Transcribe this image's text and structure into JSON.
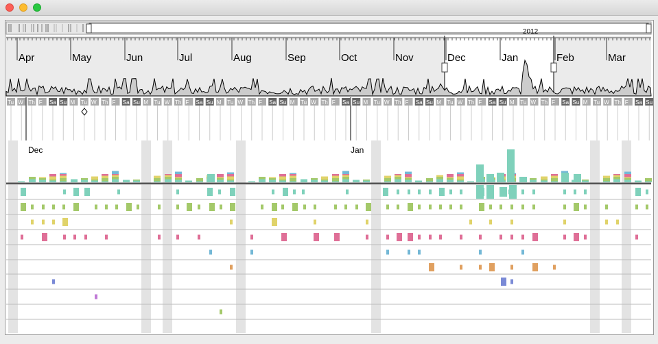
{
  "window": {
    "traffic_lights": [
      {
        "name": "close",
        "color": "#fc5f57"
      },
      {
        "name": "minimize",
        "color": "#fdbc2e"
      },
      {
        "name": "zoom",
        "color": "#28c840"
      }
    ]
  },
  "overview": {
    "year_label": "2012"
  },
  "timeline": {
    "months": [
      "Apr",
      "May",
      "Jun",
      "Jul",
      "Aug",
      "Sep",
      "Oct",
      "Nov",
      "Dec",
      "Jan",
      "Feb",
      "Mar"
    ]
  },
  "detail": {
    "day_labels": [
      "Tu",
      "W",
      "Th",
      "F",
      "Sa",
      "Su",
      "M",
      "Tu",
      "W",
      "Th",
      "F",
      "Sa",
      "Su",
      "M",
      "Tu",
      "W",
      "Th",
      "F",
      "Sa",
      "Su",
      "M",
      "Tu",
      "W",
      "Th",
      "F",
      "Sa",
      "Su",
      "M",
      "Tu",
      "W",
      "Th",
      "F",
      "Sa",
      "Su",
      "M",
      "Tu",
      "W",
      "Th",
      "F",
      "Sa",
      "Su",
      "M",
      "Tu",
      "W",
      "Th",
      "F",
      "Sa",
      "Su",
      "M",
      "Tu",
      "W",
      "Th",
      "F",
      "Sa",
      "Su",
      "M",
      "Tu",
      "W",
      "Th",
      "F",
      "Sa",
      "Su"
    ],
    "month_markers": [
      "Dec",
      "Jan"
    ]
  },
  "colors": {
    "teal": "#7fd1bb",
    "green": "#a4c96a",
    "yellow": "#e0d36a",
    "pink": "#df6f97",
    "blue": "#74b8d6",
    "orange": "#e0a060",
    "indigo": "#7a8ad6",
    "violet": "#c07ad6",
    "weekend_band": "#e3e3e3"
  }
}
